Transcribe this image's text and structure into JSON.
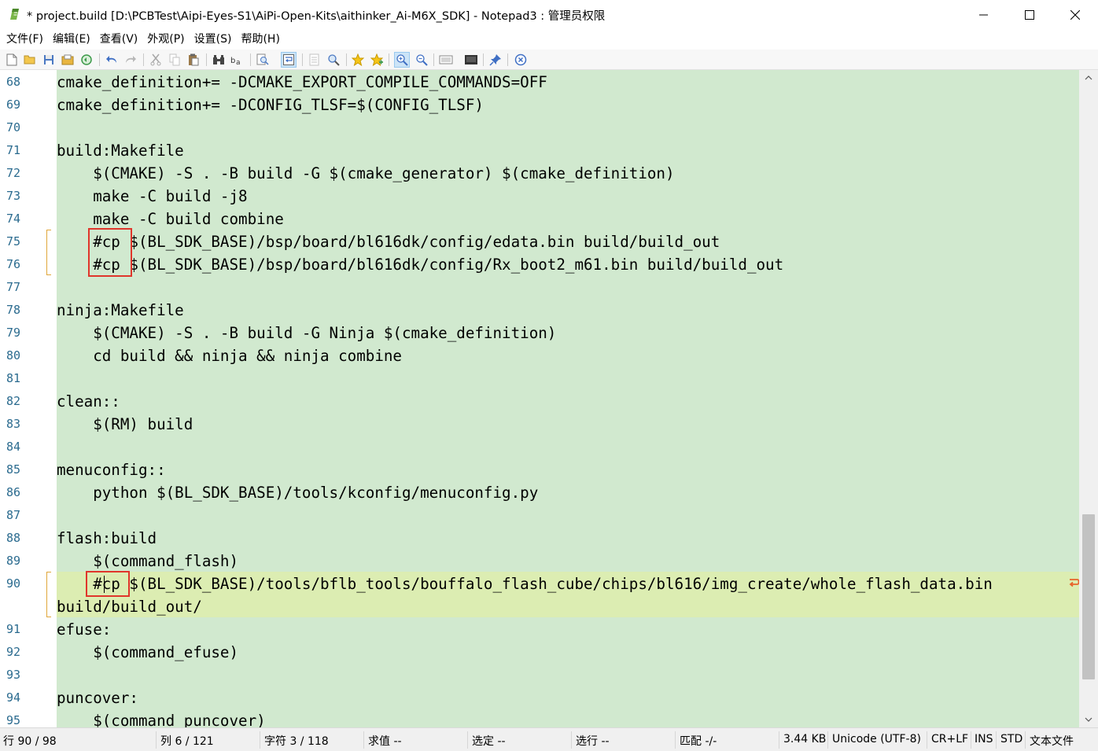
{
  "window": {
    "title": "* project.build [D:\\PCBTest\\Aipi-Eyes-S1\\AiPi-Open-Kits\\aithinker_Ai-M6X_SDK] - Notepad3 : 管理员权限"
  },
  "menu": [
    "文件(F)",
    "编辑(E)",
    "查看(V)",
    "外观(P)",
    "设置(S)",
    "帮助(H)"
  ],
  "toolbar_icons": [
    "new-file-icon",
    "open-file-icon",
    "save-icon",
    "save-as-icon",
    "revert-icon",
    "undo-icon",
    "redo-icon",
    "cut-icon",
    "copy-icon",
    "paste-icon",
    "find-icon",
    "replace-icon",
    "find-in-files-icon",
    "word-wrap-icon",
    "goto-icon",
    "find-next-icon",
    "favorites-icon",
    "add-favorite-icon",
    "zoom-in-icon",
    "zoom-out-icon",
    "page-setup-icon",
    "print-icon",
    "pin-icon",
    "close-icon"
  ],
  "editor": {
    "lines": [
      {
        "n": "68",
        "text": "cmake_definition+= -DCMAKE_EXPORT_COMPILE_COMMANDS=OFF"
      },
      {
        "n": "69",
        "text": "cmake_definition+= -DCONFIG_TLSF=$(CONFIG_TLSF)"
      },
      {
        "n": "70",
        "text": ""
      },
      {
        "n": "71",
        "text": "build:Makefile"
      },
      {
        "n": "72",
        "text": "    $(CMAKE) -S . -B build -G $(cmake_generator) $(cmake_definition)"
      },
      {
        "n": "73",
        "text": "    make -C build -j8"
      },
      {
        "n": "74",
        "text": "    make -C build combine"
      },
      {
        "n": "75",
        "text": "    #cp $(BL_SDK_BASE)/bsp/board/bl616dk/config/edata.bin build/build_out"
      },
      {
        "n": "76",
        "text": "    #cp $(BL_SDK_BASE)/bsp/board/bl616dk/config/Rx_boot2_m61.bin build/build_out"
      },
      {
        "n": "77",
        "text": ""
      },
      {
        "n": "78",
        "text": "ninja:Makefile"
      },
      {
        "n": "79",
        "text": "    $(CMAKE) -S . -B build -G Ninja $(cmake_definition)"
      },
      {
        "n": "80",
        "text": "    cd build && ninja && ninja combine"
      },
      {
        "n": "81",
        "text": ""
      },
      {
        "n": "82",
        "text": "clean::"
      },
      {
        "n": "83",
        "text": "    $(RM) build"
      },
      {
        "n": "84",
        "text": ""
      },
      {
        "n": "85",
        "text": "menuconfig::"
      },
      {
        "n": "86",
        "text": "    python $(BL_SDK_BASE)/tools/kconfig/menuconfig.py"
      },
      {
        "n": "87",
        "text": ""
      },
      {
        "n": "88",
        "text": "flash:build"
      },
      {
        "n": "89",
        "text": "    $(command_flash)"
      },
      {
        "n": "90",
        "text": "    #cp $(BL_SDK_BASE)/tools/bflb_tools/bouffalo_flash_cube/chips/bl616/img_create/whole_flash_data.bin"
      },
      {
        "n": "",
        "text": "build/build_out/"
      },
      {
        "n": "91",
        "text": "efuse:"
      },
      {
        "n": "92",
        "text": "    $(command_efuse)"
      },
      {
        "n": "93",
        "text": ""
      },
      {
        "n": "94",
        "text": "puncover:"
      },
      {
        "n": "95",
        "text": "    $(command_puncover)"
      }
    ]
  },
  "status": {
    "line": "行 90 / 98",
    "col": "列 6 / 121",
    "char": "字符 3 / 118",
    "value": "求值 --",
    "selected": "选定 --",
    "selected_lines": "选行 --",
    "match": "匹配 -/-",
    "size": "3.44 KB",
    "encoding": "Unicode (UTF-8)",
    "eol": "CR+LF",
    "ins": "INS",
    "std": "STD",
    "filetype": "文本文件"
  },
  "colors": {
    "editor_bg": "#d1e9cf",
    "current_line": "#dcedb2",
    "line_numbers": "#2b6b8f",
    "highlight_box": "#e0362b",
    "change_marker": "#e0a63a"
  }
}
